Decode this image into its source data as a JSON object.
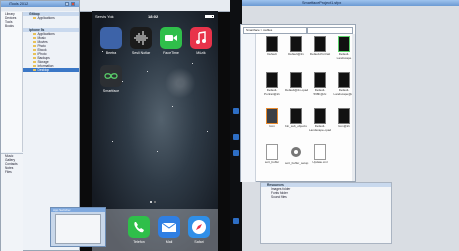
{
  "left_window": {
    "title": "iTools 2012",
    "sections": [
      {
        "header": "Gitbop",
        "items": [
          "Applications"
        ]
      },
      {
        "header": "iphone 5s",
        "items": [
          "Applications",
          "Music",
          "Movies",
          "Photo",
          "Ebook",
          "iPhoto",
          "Backups",
          "Storage",
          "Information",
          "Desktop"
        ],
        "selected_index": 9
      }
    ],
    "bottom_items": [
      "Library",
      "Devices",
      "Tools",
      "Books",
      "Music",
      "Gallery",
      "Contacts",
      "Notes",
      "Files"
    ]
  },
  "phone": {
    "status": {
      "carrier": "Servis Yok",
      "time": "18:02"
    },
    "apps_row1": [
      {
        "label": "Beetra",
        "color": "#3d63a8",
        "icon": "folder-app-icon"
      },
      {
        "label": "Sesli Notlar",
        "color": "#1b1b1b",
        "icon": "voice-memos-icon"
      },
      {
        "label": "FaceTime",
        "color": "#2fbf4a",
        "icon": "facetime-icon"
      },
      {
        "label": "Müzik",
        "color": "#e8334a",
        "icon": "music-icon"
      }
    ],
    "apps_row2": [
      {
        "label": "Smartface",
        "color": "#2c2f33",
        "icon": "smartface-icon"
      }
    ],
    "dock": [
      {
        "label": "Telefon",
        "color": "#2fbf4a",
        "icon": "phone-icon"
      },
      {
        "label": "Mail",
        "color": "#2f7fe3",
        "icon": "mail-icon"
      },
      {
        "label": "Safari",
        "color": "#2f8fe8",
        "icon": "safari-icon"
      }
    ],
    "switcher_label": "App Switcher"
  },
  "explorer": {
    "title": "Smartface > iosfiles",
    "files": [
      {
        "name": "Default",
        "kind": "black"
      },
      {
        "name": "Default@2x",
        "kind": "black"
      },
      {
        "name": "Default-Portrait",
        "kind": "black"
      },
      {
        "name": "Default-Landscape",
        "kind": "black"
      },
      {
        "name": "Default-Portrait@2x",
        "kind": "black"
      },
      {
        "name": "Default@2x~ipad",
        "kind": "black"
      },
      {
        "name": "Default-568h@2x",
        "kind": "black"
      },
      {
        "name": "Default-Landscape@2x",
        "kind": "black"
      },
      {
        "name": "Icon",
        "kind": "sublime"
      },
      {
        "name": "bin_sub_objects",
        "kind": "black"
      },
      {
        "name": "Default-Landscape~ipad",
        "kind": "black"
      },
      {
        "name": "Icon@2x",
        "kind": "black"
      },
      {
        "name": "sort_buffer",
        "kind": "doc"
      },
      {
        "name": "sort_buffer_setup",
        "kind": "gear"
      },
      {
        "name": "Update.xml",
        "kind": "doc"
      }
    ]
  },
  "right_panel": {
    "title": "SmartfaceProject1.sfpx",
    "tree_header": "Resources",
    "tree_items": [
      "Images folder",
      "Fonts folder",
      "Sound files"
    ]
  },
  "colors": {
    "accent": "#3a77c6",
    "title_bar": "#7ea8de"
  }
}
